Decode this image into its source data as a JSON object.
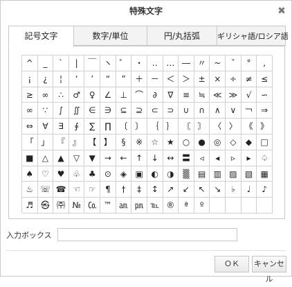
{
  "dialog": {
    "title": "特殊文字",
    "close_icon": "close-icon"
  },
  "tabs": [
    {
      "label": "記号文字",
      "active": true
    },
    {
      "label": "数字/単位",
      "active": false
    },
    {
      "label": "円/丸括弧",
      "active": false
    },
    {
      "label": "ギリシャ語/ロシア語",
      "active": false
    }
  ],
  "symbols": [
    [
      "^",
      "_",
      "`",
      "|",
      "￣",
      "ヽ",
      "゜",
      "・",
      "‥",
      "…",
      "―",
      "〃",
      "~",
      "ˇ",
      "°",
      ","
    ],
    [
      "¡",
      "¿",
      "¦",
      "‘",
      "’",
      "“",
      "”",
      "＋",
      "－",
      "＜",
      "＞",
      "±",
      "×",
      "÷",
      "≠",
      "≤"
    ],
    [
      "≥",
      "∞",
      "∴",
      "♂",
      "♀",
      "∠",
      "⊥",
      "⌒",
      "∂",
      "∇",
      "≡",
      "≒",
      "≪",
      "≫",
      "√",
      "∽"
    ],
    [
      "∞",
      "∵",
      "∫",
      "∬",
      "∈",
      "∋",
      "⊆",
      "⊇",
      "⊂",
      "⊃",
      "∪",
      "∩",
      "∧",
      "∨",
      "￢",
      "⇒"
    ],
    [
      "⇔",
      "∀",
      "∃",
      "∮",
      "∑",
      "∏",
      "〔",
      "〕",
      "｛",
      "｝",
      "〘",
      "〙",
      "〈",
      "〉",
      "《",
      "》"
    ],
    [
      "「",
      "」",
      "『",
      "』",
      "【",
      "】",
      "§",
      "※",
      "☆",
      "★",
      "○",
      "●",
      "◎",
      "◇",
      "◆",
      "□"
    ],
    [
      "■",
      "△",
      "▲",
      "▽",
      "▼",
      "→",
      "←",
      "↑",
      "↓",
      "↔",
      "〓",
      "◃",
      "◂",
      "▹",
      "▸",
      "♤"
    ],
    [
      "♠",
      "♡",
      "♥",
      "♧",
      "♣",
      "⊙",
      "◈",
      "▣",
      "◐",
      "◑",
      "▒",
      "▤",
      "▥",
      "▨",
      "▧",
      "▦"
    ],
    [
      "♨",
      "☏",
      "☎",
      "☜",
      "☞",
      "¶",
      "†",
      "‡",
      "↕",
      "↗",
      "↙",
      "↖",
      "↘",
      "♭",
      "♩",
      "♪"
    ],
    [
      "♬",
      "㉿",
      "㈜",
      "№",
      "㏇",
      "™",
      "㏂",
      "㏘",
      "℡",
      "®",
      "ª",
      "º",
      "",
      "",
      "",
      ""
    ]
  ],
  "input": {
    "label": "入力ボックス",
    "value": "",
    "placeholder": ""
  },
  "buttons": {
    "ok": "ＯＫ",
    "cancel": "キャンセル"
  }
}
